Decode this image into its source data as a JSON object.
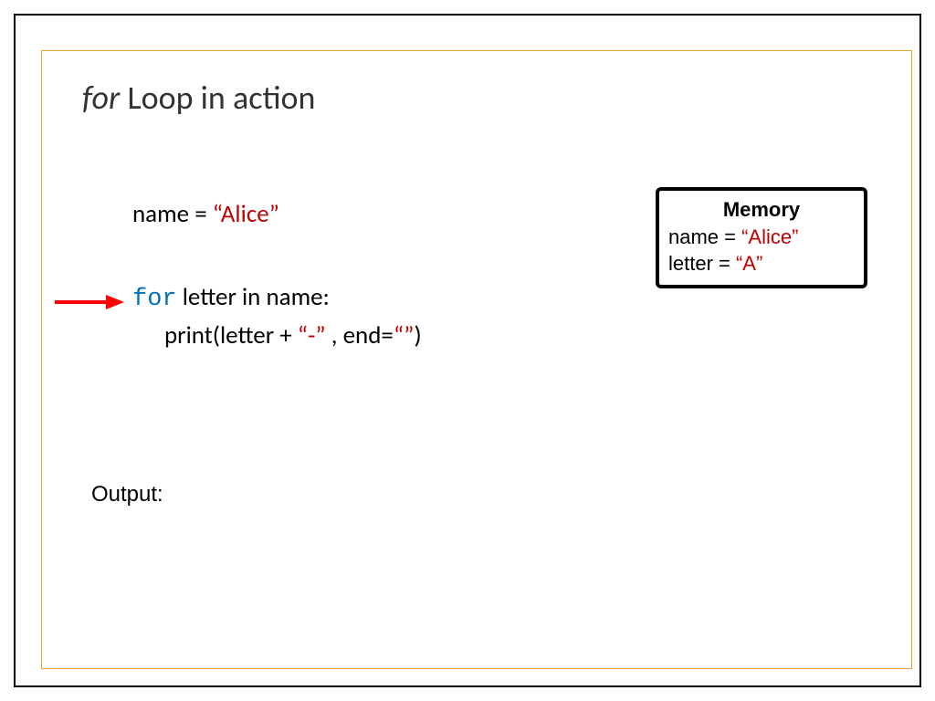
{
  "title": {
    "italic": "for",
    "rest": " Loop in action"
  },
  "code": {
    "line1_pre": "name = ",
    "line1_str": "“Alice”",
    "line2_for": "for",
    "line2_rest": " letter in name:",
    "line3_pre": "print(letter + ",
    "line3_dash": "“-”",
    "line3_mid": " , end=",
    "line3_empty": "“”",
    "line3_post": ")"
  },
  "memory": {
    "title": "Memory",
    "row1_key": "name = ",
    "row1_val": "“Alice”",
    "row2_key": "letter = ",
    "row2_val": "“A”"
  },
  "output_label": "Output:"
}
